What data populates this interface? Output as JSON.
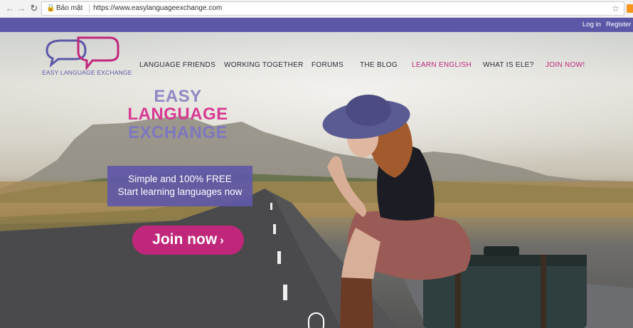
{
  "browser": {
    "secure_label": "Bảo mật",
    "url": "https://www.easylanguageexchange.com",
    "back_icon": "arrow-left-icon",
    "forward_icon": "arrow-right-icon",
    "reload_icon": "reload-icon",
    "star_icon": "star-icon",
    "lock_icon": "lock-icon"
  },
  "topbar": {
    "login": "Log in",
    "register": "Register",
    "color": "#5c58a7"
  },
  "header": {
    "logo_text": "EASY LANGUAGE EXCHANGE",
    "nav": [
      {
        "label": "LANGUAGE FRIENDS"
      },
      {
        "label": "WORKING TOGETHER"
      },
      {
        "label": "FORUMS"
      },
      {
        "label": "THE BLOG"
      },
      {
        "label": "LEARN ENGLISH"
      },
      {
        "label": "WHAT IS ELE?"
      },
      {
        "label": "JOIN NOW!"
      }
    ]
  },
  "hero": {
    "headline_1": "EASY",
    "headline_2": "LANGUAGE",
    "headline_3": "EXCHANGE",
    "promo_line_1": "Simple and 100% FREE",
    "promo_line_2": "Start learning languages now",
    "cta": "Join now",
    "cta_icon": "chevron-right-icon",
    "accent": "#c0277b",
    "brand": "#5c58a7"
  }
}
